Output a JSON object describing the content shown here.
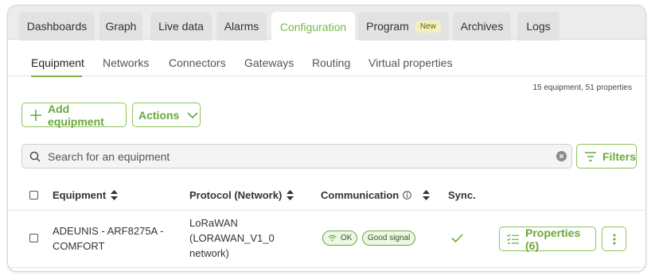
{
  "tabs": [
    {
      "label": "Dashboards"
    },
    {
      "label": "Graph"
    },
    {
      "label": "Live data"
    },
    {
      "label": "Alarms"
    },
    {
      "label": "Configuration",
      "active": true
    },
    {
      "label": "Program",
      "badge": "New"
    },
    {
      "label": "Archives"
    },
    {
      "label": "Logs"
    }
  ],
  "subtabs": [
    "Equipment",
    "Networks",
    "Connectors",
    "Gateways",
    "Routing",
    "Virtual properties"
  ],
  "summary": "15 equipment, 51 properties",
  "toolbar": {
    "add_label": "Add equipment",
    "actions_label": "Actions"
  },
  "search": {
    "placeholder": "Search for an equipment",
    "filters_label": "Filters"
  },
  "table": {
    "headers": {
      "equipment": "Equipment",
      "protocol": "Protocol (Network)",
      "communication": "Communication",
      "sync": "Sync."
    },
    "rows": [
      {
        "equipment_line1": "ADEUNIS - ARF8275A -",
        "equipment_line2": "COMFORT",
        "protocol_line1": "LoRaWAN",
        "protocol_line2": "(LORAWAN_V1_0",
        "protocol_line3": "network)",
        "status": "OK",
        "signal": "Good signal",
        "properties_label": "Properties (6)"
      }
    ]
  },
  "colors": {
    "accent": "#7ab648",
    "border": "#d6d6d6"
  }
}
